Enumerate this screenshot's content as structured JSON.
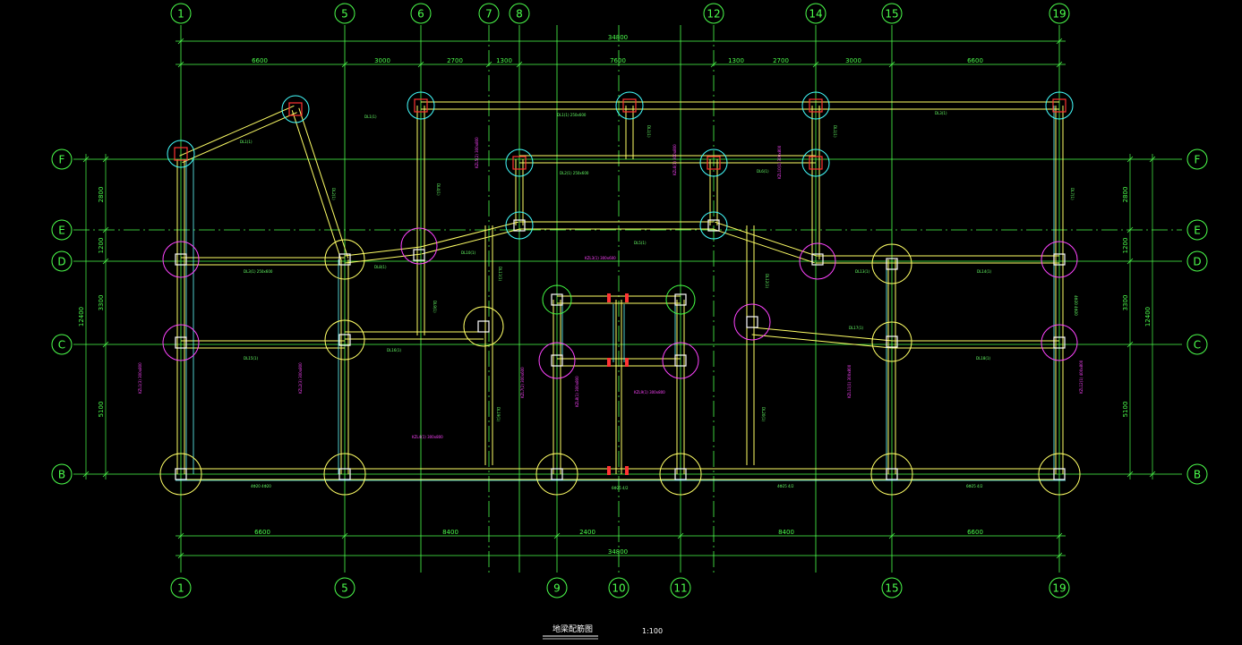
{
  "drawing": {
    "title": "地梁配筋图",
    "scale": "1:100"
  },
  "colors": {
    "background": "#000000",
    "axis": "#4cff4c",
    "beam": "#ffff66",
    "beam_inner": "#66ffff",
    "column_fill": "#ff3333",
    "circle_pile": "#ffff66",
    "circle_mag": "#ff44ff",
    "circle_cyan": "#44ffff",
    "annotation_green": "#66ff66",
    "annotation_magenta": "#ff44ff",
    "title": "#ffffff"
  },
  "axes": {
    "top_labels": [
      "1",
      "5",
      "6",
      "7",
      "8",
      "12",
      "14",
      "15",
      "19"
    ],
    "bottom_labels": [
      "1",
      "5",
      "9",
      "10",
      "11",
      "15",
      "19"
    ],
    "row_labels": [
      "F",
      "E",
      "D",
      "C",
      "B"
    ]
  },
  "dimensions": {
    "top_total": "34800",
    "top_segments": [
      "6600",
      "3000",
      "2700",
      "1300",
      "7600",
      "1300",
      "2700",
      "3000",
      "6600"
    ],
    "bottom_total": "34800",
    "bottom_segments": [
      "6600",
      "8400",
      "2400",
      "8400",
      "6600"
    ],
    "left_total": "12400",
    "left_segments": [
      "2800",
      "1200",
      "3300",
      "5100"
    ],
    "right_total": "12400",
    "right_segments": [
      "2800",
      "1200",
      "3300",
      "5100"
    ]
  },
  "beam_labels": {
    "dl1_a": "DL1(1)",
    "dl1_b": "DL1(1)",
    "dl1_c": "DL1(1)",
    "dl1_d": "DL1(1)",
    "dl2": "DL2(1)",
    "dl3": "DL3(1)",
    "dl4": "DL4(1)",
    "dl5": "DL5(1)",
    "dl6": "DL6(1)",
    "dl7": "DL7(1)",
    "dl8": "DL8(1)",
    "dl9": "DL9(1)",
    "dl10": "DL10(1)",
    "dl11": "DL11(1)",
    "dl12": "DL12(1)",
    "dl13": "DL13(1)",
    "dl14": "DL14(1)",
    "dl15": "DL15(1)",
    "dl16": "DL16(1)",
    "dl17": "DL17(1)",
    "dl18": "DL18(1)",
    "dl19": "DL19(1)",
    "dl20": "DL20(1)"
  },
  "magenta_notes": {
    "n1": "KZL1(3) 300x800",
    "n2": "KZL2(3) 300x800",
    "n3": "KZL3(1) 300x600",
    "n4": "KZL4(1) 300x800",
    "n5": "KZL5(2) 300x800",
    "n6": "KZL6(1) 300x800",
    "n7": "KZL7(2) 300x600",
    "n8": "KZL8(1) 300x800",
    "n9": "KZL9(1) 300x800",
    "n10": "KZL10(1) 300x800",
    "n11": "KZL11(1) 300x800",
    "n12": "KZL12(1) 400x800"
  },
  "green_notes": {
    "g1": "DL1(1) 250x600",
    "g2": "DL2(1) 250x600",
    "g3": "DL3(1) 250x600",
    "g4": "4Φ20 4Φ20",
    "g5": "6Φ25 4/2",
    "g6": "4Φ25 4/2",
    "g7": "6Φ25 4/2",
    "g8": "4Φ20 4Φ20"
  }
}
